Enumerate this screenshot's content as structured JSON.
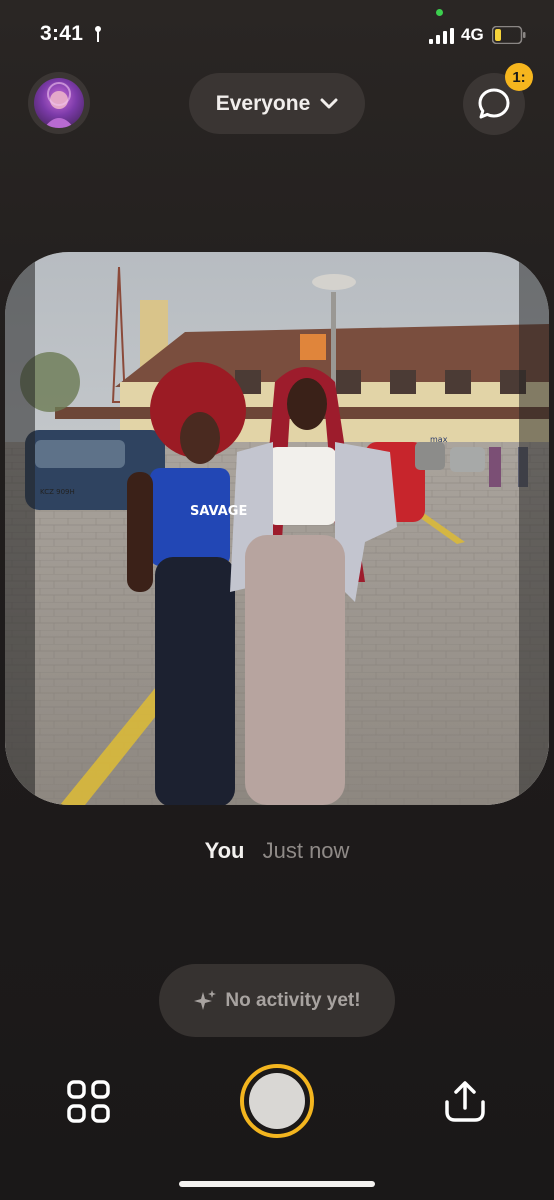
{
  "status_bar": {
    "time": "3:41",
    "network": "4G",
    "battery_level": 0.25,
    "battery_color": "#f5d33a"
  },
  "header": {
    "audience_label": "Everyone",
    "chat_badge": "1:"
  },
  "post": {
    "author": "You",
    "timestamp": "Just now",
    "photo_text": {
      "shirt": "SAVAGE",
      "sign": "max",
      "plate": "KCZ 909H"
    }
  },
  "activity": {
    "label": "No activity yet!"
  },
  "icons": {
    "location": "location-arrow-icon",
    "audience_chevron": "chevron-down-icon",
    "chat": "chat-bubble-icon",
    "sparkle": "sparkle-icon",
    "grid": "grid-icon",
    "share": "share-icon"
  },
  "colors": {
    "accent": "#f3b51f",
    "background": "#221f1e"
  }
}
